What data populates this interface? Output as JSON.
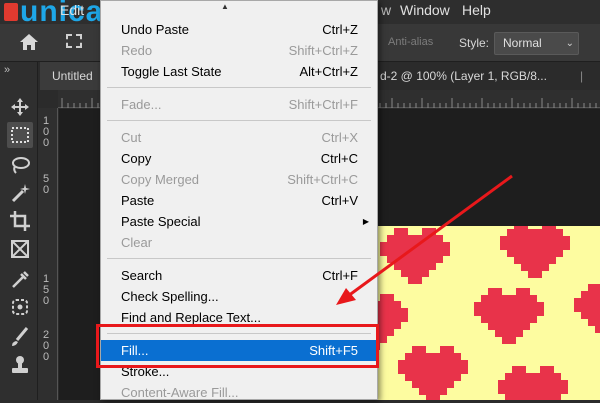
{
  "watermark": {
    "text": "unica"
  },
  "menubar": {
    "edit_label": "Edit",
    "items": [
      "View",
      "Window",
      "Help"
    ]
  },
  "options_bar": {
    "antialias_label": "Anti-alias",
    "style_label": "Style:",
    "style_value": "Normal"
  },
  "tabs": {
    "left": "Untitled",
    "right": "d-2 @ 100% (Layer 1, RGB/8..."
  },
  "toolbar": {
    "tools": [
      "move-tool",
      "marquee-tool",
      "lasso-tool",
      "magic-wand-tool",
      "crop-tool",
      "frame-tool",
      "eyedropper-tool",
      "healing-brush-tool",
      "brush-tool",
      "clone-stamp-tool"
    ]
  },
  "rulers": {
    "left_numbers": [
      "1\n0\n0",
      "5\n0",
      "1\n5\n0",
      "2\n0\n0"
    ]
  },
  "edit_menu": {
    "items": [
      {
        "label": "Undo Paste",
        "shortcut": "Ctrl+Z",
        "enabled": true
      },
      {
        "label": "Redo",
        "shortcut": "Shift+Ctrl+Z",
        "enabled": false
      },
      {
        "label": "Toggle Last State",
        "shortcut": "Alt+Ctrl+Z",
        "enabled": true
      },
      {
        "label": "Fade...",
        "shortcut": "Shift+Ctrl+F",
        "enabled": false
      },
      {
        "label": "Cut",
        "shortcut": "Ctrl+X",
        "enabled": false
      },
      {
        "label": "Copy",
        "shortcut": "Ctrl+C",
        "enabled": true
      },
      {
        "label": "Copy Merged",
        "shortcut": "Shift+Ctrl+C",
        "enabled": false
      },
      {
        "label": "Paste",
        "shortcut": "Ctrl+V",
        "enabled": true
      },
      {
        "label": "Paste Special",
        "shortcut": "",
        "enabled": true,
        "submenu": true
      },
      {
        "label": "Clear",
        "shortcut": "",
        "enabled": false
      },
      {
        "label": "Search",
        "shortcut": "Ctrl+F",
        "enabled": true
      },
      {
        "label": "Check Spelling...",
        "shortcut": "",
        "enabled": true
      },
      {
        "label": "Find and Replace Text...",
        "shortcut": "",
        "enabled": true
      },
      {
        "label": "Fill...",
        "shortcut": "Shift+F5",
        "enabled": true,
        "selected": true
      },
      {
        "label": "Stroke...",
        "shortcut": "",
        "enabled": true
      },
      {
        "label": "Content-Aware Fill...",
        "shortcut": "",
        "enabled": false
      }
    ]
  },
  "colors": {
    "menu_selected": "#0a6fd1",
    "annotation": "#e8181b",
    "heart": "#e8334a",
    "canvas": "#fdfca0"
  }
}
